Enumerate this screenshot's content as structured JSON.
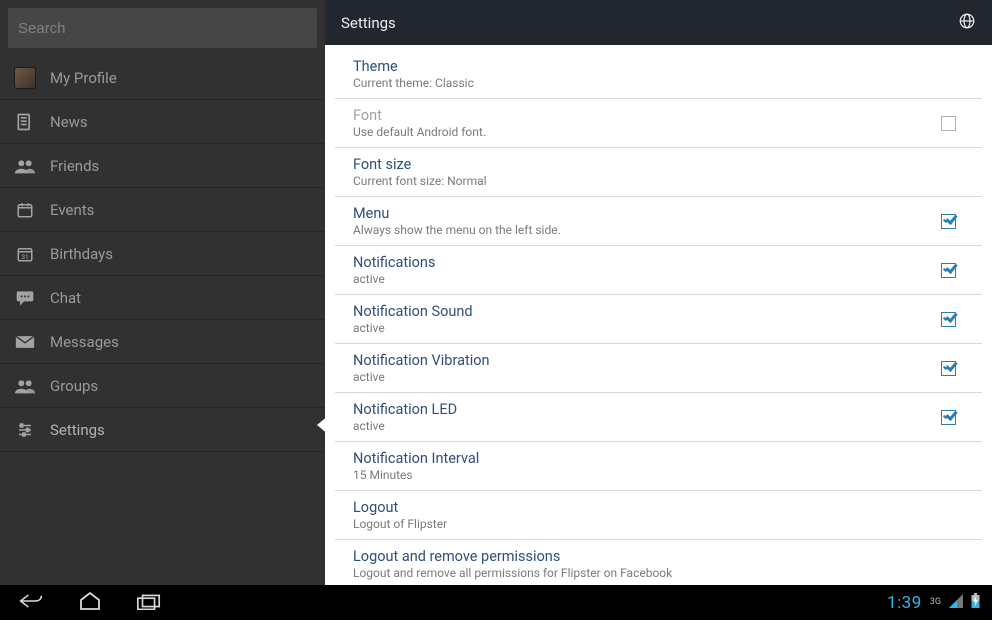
{
  "sidebar": {
    "search_placeholder": "Search",
    "items": [
      {
        "label": "My Profile",
        "icon": "avatar"
      },
      {
        "label": "News",
        "icon": "news"
      },
      {
        "label": "Friends",
        "icon": "friends"
      },
      {
        "label": "Events",
        "icon": "calendar"
      },
      {
        "label": "Birthdays",
        "icon": "birthday"
      },
      {
        "label": "Chat",
        "icon": "chat"
      },
      {
        "label": "Messages",
        "icon": "mail"
      },
      {
        "label": "Groups",
        "icon": "group"
      },
      {
        "label": "Settings",
        "icon": "settings"
      }
    ]
  },
  "header": {
    "title": "Settings"
  },
  "settings": [
    {
      "title": "Theme",
      "sub": "Current theme: Classic",
      "check": null
    },
    {
      "title": "Font",
      "sub": "Use default Android font.",
      "check": false,
      "disabled": true
    },
    {
      "title": "Font size",
      "sub": "Current font size: Normal",
      "check": null
    },
    {
      "title": "Menu",
      "sub": "Always show the menu on the left side.",
      "check": true
    },
    {
      "title": "Notifications",
      "sub": "active",
      "check": true
    },
    {
      "title": "Notification Sound",
      "sub": "active",
      "check": true
    },
    {
      "title": "Notification Vibration",
      "sub": "active",
      "check": true
    },
    {
      "title": "Notification LED",
      "sub": "active",
      "check": true
    },
    {
      "title": "Notification Interval",
      "sub": "15 Minutes",
      "check": null
    },
    {
      "title": "Logout",
      "sub": "Logout of Flipster",
      "check": null
    },
    {
      "title": "Logout and remove permissions",
      "sub": "Logout and remove all permissions for Flipster on Facebook",
      "check": null
    }
  ],
  "statusbar": {
    "clock": "1:39",
    "signal": "3G"
  }
}
